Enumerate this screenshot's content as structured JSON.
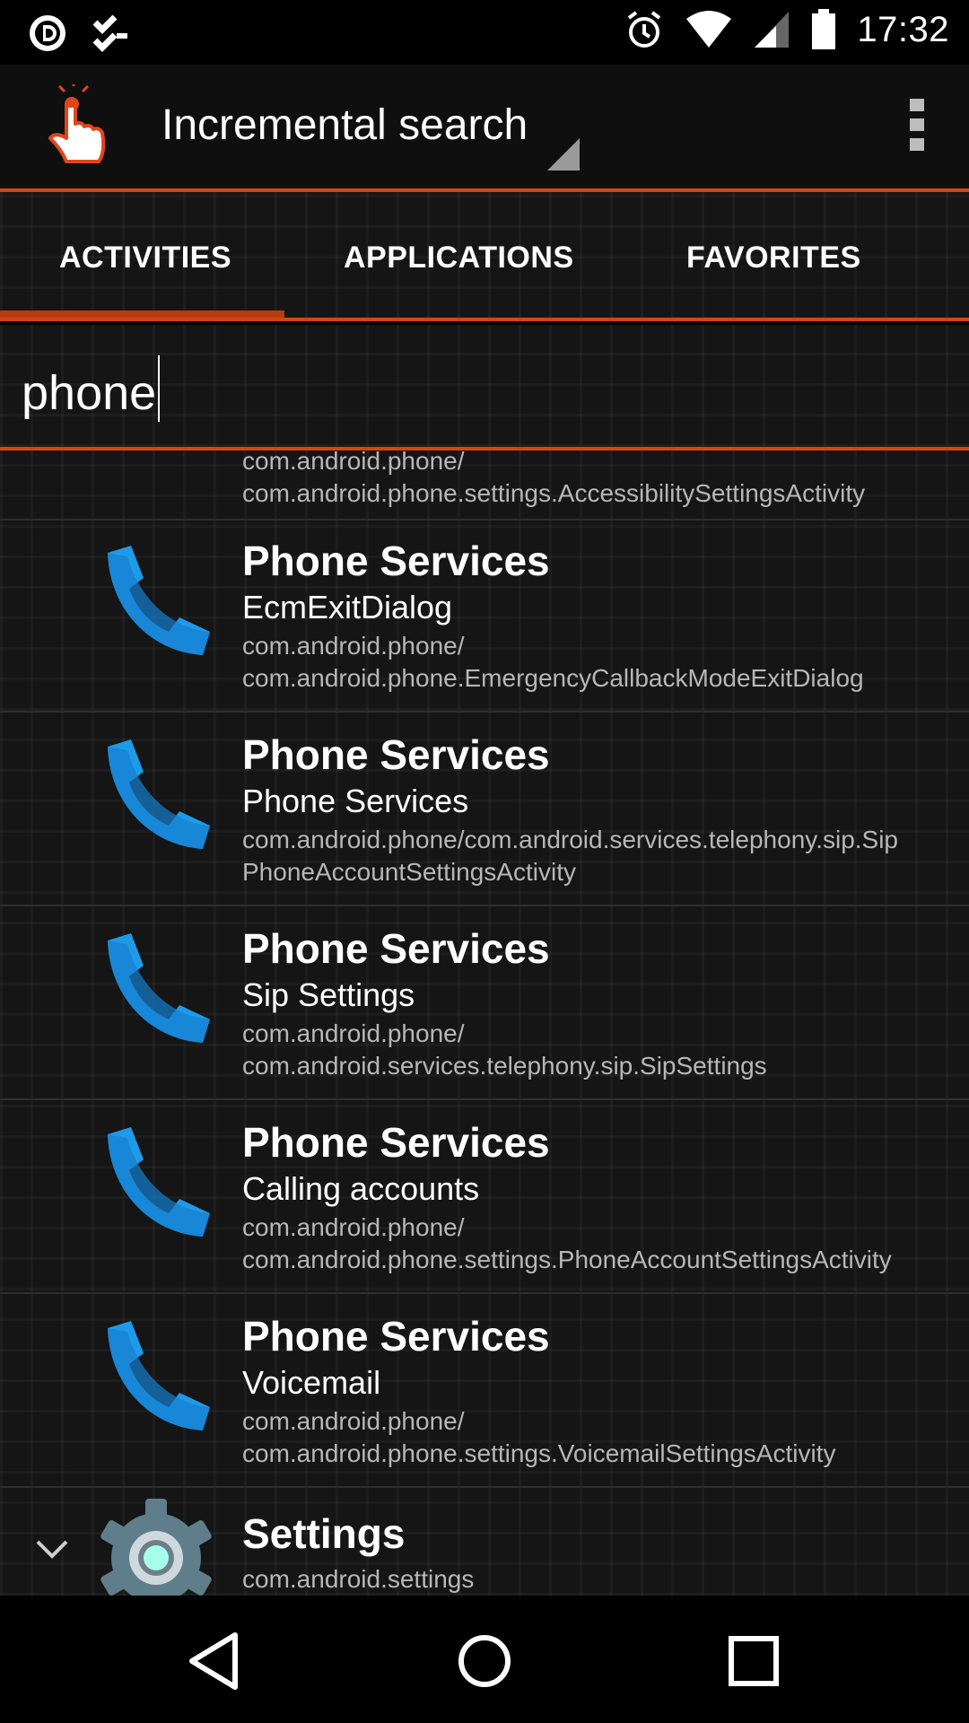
{
  "status_bar": {
    "time": "17:32",
    "icons_left": [
      "d-badge-icon",
      "check-list-icon"
    ],
    "icons_right": [
      "alarm-icon",
      "wifi-icon",
      "signal-icon",
      "battery-icon"
    ]
  },
  "action_bar": {
    "title": "Incremental search",
    "menu_icon": "overflow-menu-icon"
  },
  "tabs": [
    {
      "label": "ACTIVITIES",
      "selected": true
    },
    {
      "label": "APPLICATIONS",
      "selected": false
    },
    {
      "label": "FAVORITES",
      "selected": false
    }
  ],
  "search": {
    "value": "phone"
  },
  "list": {
    "partial_item": {
      "package": "com.android.phone/",
      "activity": "com.android.phone.settings.AccessibilitySettingsActivity"
    },
    "items": [
      {
        "app": "Phone Services",
        "label": "EcmExitDialog",
        "package": "com.android.phone/",
        "activity": "com.android.phone.EmergencyCallbackModeExitDialog",
        "icon": "phone-icon"
      },
      {
        "app": "Phone Services",
        "label": "Phone Services",
        "package": "com.android.phone/com.android.services.telephony.sip.Sip",
        "activity": "PhoneAccountSettingsActivity",
        "icon": "phone-icon"
      },
      {
        "app": "Phone Services",
        "label": "Sip Settings",
        "package": "com.android.phone/",
        "activity": "com.android.services.telephony.sip.SipSettings",
        "icon": "phone-icon"
      },
      {
        "app": "Phone Services",
        "label": "Calling accounts",
        "package": "com.android.phone/",
        "activity": "com.android.phone.settings.PhoneAccountSettingsActivity",
        "icon": "phone-icon"
      },
      {
        "app": "Phone Services",
        "label": "Voicemail",
        "package": "com.android.phone/",
        "activity": "com.android.phone.settings.VoicemailSettingsActivity",
        "icon": "phone-icon"
      }
    ],
    "settings_item": {
      "app": "Settings",
      "package": "com.android.settings",
      "icon": "settings-gear-icon"
    }
  },
  "nav_bar": {
    "back": "back-icon",
    "home": "home-icon",
    "recents": "recents-icon"
  },
  "colors": {
    "accent": "#d64510",
    "phone_icon": "#1e9be8"
  }
}
